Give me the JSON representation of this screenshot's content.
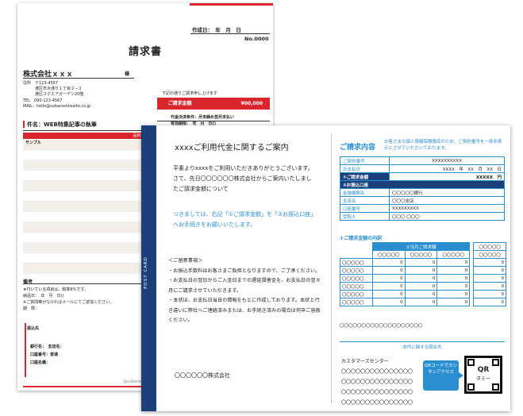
{
  "invoice": {
    "date": "作成日：　年　月　日",
    "number": "No.0000",
    "title": "請求書",
    "company": "株式会社ｘｘｘ",
    "honorific": "様",
    "address_lines": [
      "住所　〒123-4567",
      "　　　港区市大通り１丁目２−３",
      "　　　港区スクエアガーデン20階",
      "TEL　090-123-4567",
      "MAIL：hello@subarashiisaito.co.jp"
    ],
    "pay_note": "下記の通りご請求申し上げます",
    "bill_label": "ご請求金額",
    "bill_amount": "¥00,000",
    "terms": [
      "代金決済条件：月末締め翌月末払い",
      "有効期限：　年　月　日()"
    ],
    "subject": "件名：WEB特集記事の執筆",
    "table_header": "品目／商品番号",
    "sample": "サンプル",
    "remarks_title": "備考",
    "remarks": [
      "★付いている項目は、税率8%です。",
      "納品日：　年　月　日()",
      "※ご質問等がなければメールにてご返信ください。",
      "期　限："
    ],
    "bank_title": "振込先",
    "bank_lines": [
      "銀行名：　支店名：",
      "口座番号：普通",
      "口座名義："
    ],
    "footer": "@subarashiisaito.co.jp"
  },
  "postcard": {
    "spine_label": "POST CARD",
    "title": "xxxxご利用代金に関するご案内",
    "intro": "平素よりxxxxをご利用いただきありがとうございます。　さて、先日〇〇〇〇〇〇株式会社からご案内いたしましたご請求金額について",
    "highlight": "つきましては、右記「①ご請求金額」を「②お振込口座」へお手続きをお願いいたします。",
    "notes_title": "＜ご留意事項＞",
    "notes": [
      "・お振込手数料はお客さまご負担となりますので、ご了承ください。",
      "・お支払日の翌日からご入金日までの遅延損害金を、お支払日の翌々月にご請求させていただきます。",
      "・本状は、お支払日当日の情報をもとに作成しております。本状と行き違いに弊社へご連絡済みまたは、お手続き済みの場合は何卒ご容赦ください。"
    ],
    "company": "〇〇〇〇〇〇株式会社",
    "right_title": "ご請求内容",
    "right_note": "お客さまの個人情報保護徹底のため、ご契約番号を一部非表示とさせていただいております。",
    "contract_rows": [
      {
        "label": "ご契約番号",
        "value": "XXXXXXXXXX"
      },
      {
        "label": "お支払日",
        "value": "XXXX　年　XX　月　XX　日"
      }
    ],
    "amount_label": "①ご請求金額",
    "amount_value": "XXXXX　円",
    "account_label": "②お振込口座",
    "account_rows": [
      {
        "label": "金融機関名",
        "value": "〇〇〇〇〇銀行"
      },
      {
        "label": "支店名",
        "value": "〇〇〇支店"
      },
      {
        "label": "口座番号",
        "value": "XXXXXXXXX"
      },
      {
        "label": "受取人",
        "value": "〇〇〇 〇〇〇"
      }
    ],
    "breakdown_title": "①ご請求金額の内訳",
    "breakdown_header": "①当月ご請求額",
    "breakdown_cell": "〇〇〇〇〇",
    "zero": "0",
    "breakdown_rows": [
      "〇〇〇〇〇",
      "〇〇〇〇〇",
      "〇〇〇〇〇",
      "〇〇〇〇〇",
      "〇〇〇〇〇",
      "〇〇〇〇〇"
    ],
    "dots_row": "〇〇〇〇〇〇〇〇〇〇〇〇〇〇〇〇〇〇〇",
    "inquiry_title": "本件に関する問合先",
    "customer_center": "カスタマーズセンター",
    "cs_lines": [
      "〇〇〇〇〇〇〇〇〇〇〇〇〇〇〇",
      "〇〇〇〇〇〇〇〇〇〇〇〇〇〇〇",
      "〇〇〇〇〇〇〇〇〇〇〇〇〇〇〇",
      "〇〇〇〇〇〇〇〇〇〇〇〇〇〇〇"
    ],
    "bubble_text": "QRコードでカンタンアクセス",
    "qr_text": "QR",
    "qr_sub": "ダミー"
  }
}
